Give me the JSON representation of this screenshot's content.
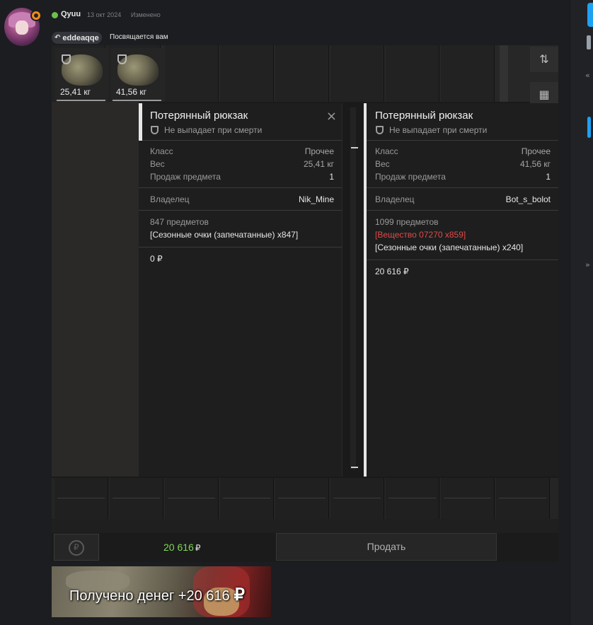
{
  "post": {
    "username": "Qyuu",
    "date": "13 окт 2024",
    "edited": "Изменено",
    "reply_to": "eddeaqqe",
    "dedication": "Посвящается вам"
  },
  "game": {
    "items": [
      {
        "weight": "25,41 кг"
      },
      {
        "weight": "41,56 кг"
      }
    ],
    "panels": [
      {
        "title": "Потерянный рюкзак",
        "subtitle": "Не выпадает при смерти",
        "close": "×",
        "rows": [
          {
            "key": "Класс",
            "value": "Прочее"
          },
          {
            "key": "Вес",
            "value": "25,41 кг"
          },
          {
            "key": "Продаж предмета",
            "value": "1"
          }
        ],
        "owner_label": "Владелец",
        "owner": "Nik_Mine",
        "count": "847 предметов",
        "contents": [
          "[Сезонные очки (запечатанные) x847]"
        ],
        "price": "0 ₽"
      },
      {
        "title": "Потерянный рюкзак",
        "subtitle": "Не выпадает при смерти",
        "rows": [
          {
            "key": "Класс",
            "value": "Прочее"
          },
          {
            "key": "Вес",
            "value": "41,56 кг"
          },
          {
            "key": "Продаж предмета",
            "value": "1"
          }
        ],
        "owner_label": "Владелец",
        "owner": "Bot_s_bolot",
        "count": "1099 предметов",
        "contents_red": "[Вещество 07270 x859]",
        "contents": [
          "[Сезонные очки (запечатанные) x240]"
        ],
        "price": "20 616 ₽"
      }
    ],
    "total": "20 616",
    "currency": "₽",
    "sell_label": "Продать"
  },
  "toast": {
    "message": "Получено денег +20 616",
    "currency": "₽"
  },
  "colors": {
    "accent_blue": "#1da1f2",
    "money_green": "#7ed957",
    "warning_red": "#e04a4a"
  }
}
